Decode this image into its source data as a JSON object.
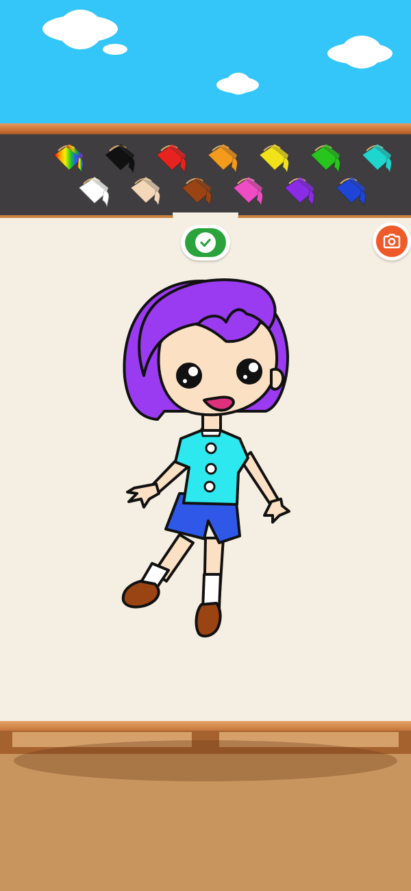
{
  "palette": {
    "colors": [
      {
        "name": "rainbow",
        "hex": "rainbow"
      },
      {
        "name": "black",
        "hex": "#111111"
      },
      {
        "name": "red",
        "hex": "#e8231f"
      },
      {
        "name": "orange",
        "hex": "#f49a1c"
      },
      {
        "name": "yellow",
        "hex": "#f1e21a"
      },
      {
        "name": "green",
        "hex": "#27c51d"
      },
      {
        "name": "cyan",
        "hex": "#1fd6cf"
      },
      {
        "name": "white",
        "hex": "#ffffff"
      },
      {
        "name": "skin",
        "hex": "#f3d7b8"
      },
      {
        "name": "brown",
        "hex": "#9a4414"
      },
      {
        "name": "pink",
        "hex": "#ee4dc4"
      },
      {
        "name": "purple",
        "hex": "#8a2be6"
      },
      {
        "name": "blue",
        "hex": "#1f45d8"
      }
    ]
  },
  "buttons": {
    "confirm_icon": "check-icon",
    "camera_icon": "camera-icon"
  },
  "character": {
    "hair": "#9a3bf1",
    "skin": "#fbe0c4",
    "shirt": "#2de9ef",
    "shorts": "#2f58e8",
    "shoes": "#9a4414",
    "socks": "#ffffff"
  }
}
